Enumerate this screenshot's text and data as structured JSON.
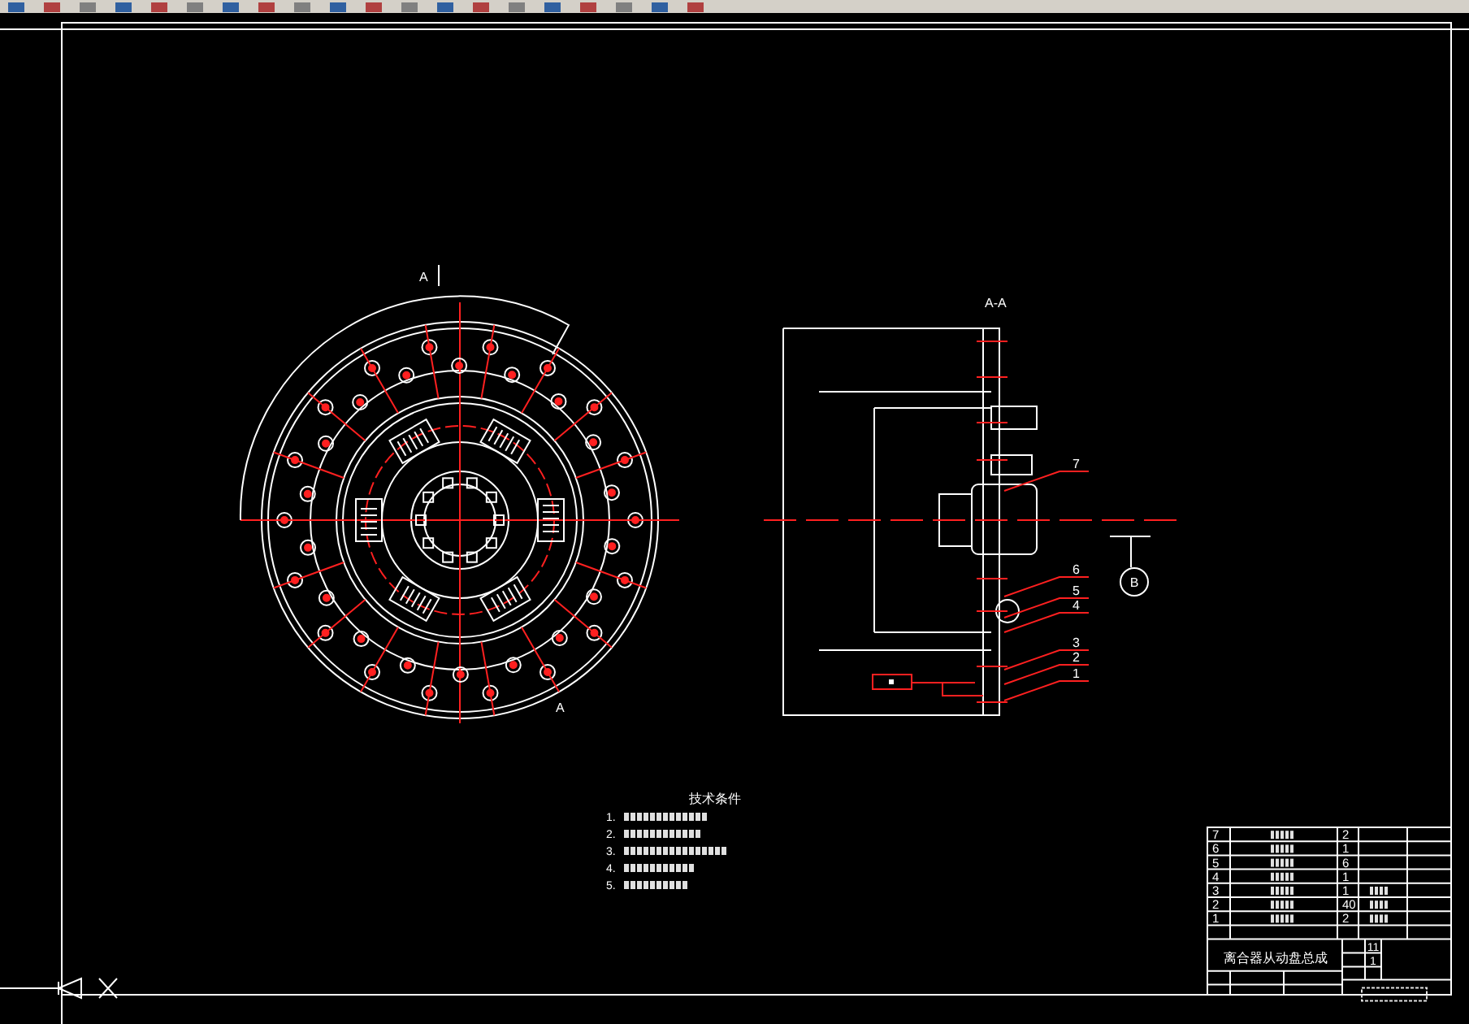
{
  "drawing": {
    "section_markers": [
      "A",
      "A"
    ],
    "section_title": "A-A",
    "detail_marker": "B",
    "callouts": [
      "7",
      "6",
      "5",
      "4",
      "3",
      "2",
      "1"
    ],
    "notes": {
      "title": "技术条件",
      "items": [
        "1.",
        "2.",
        "3.",
        "4.",
        "5."
      ]
    },
    "parts_list": {
      "rows": [
        {
          "no": "7",
          "qty": "2",
          "material": false
        },
        {
          "no": "6",
          "qty": "1",
          "material": false
        },
        {
          "no": "5",
          "qty": "6",
          "material": false
        },
        {
          "no": "4",
          "qty": "1",
          "material": false
        },
        {
          "no": "3",
          "qty": "1",
          "material": true
        },
        {
          "no": "2",
          "qty": "40",
          "material": true
        },
        {
          "no": "1",
          "qty": "2",
          "material": true
        }
      ],
      "title": "离合器从动盘总成",
      "values": [
        "11",
        "1"
      ]
    }
  }
}
